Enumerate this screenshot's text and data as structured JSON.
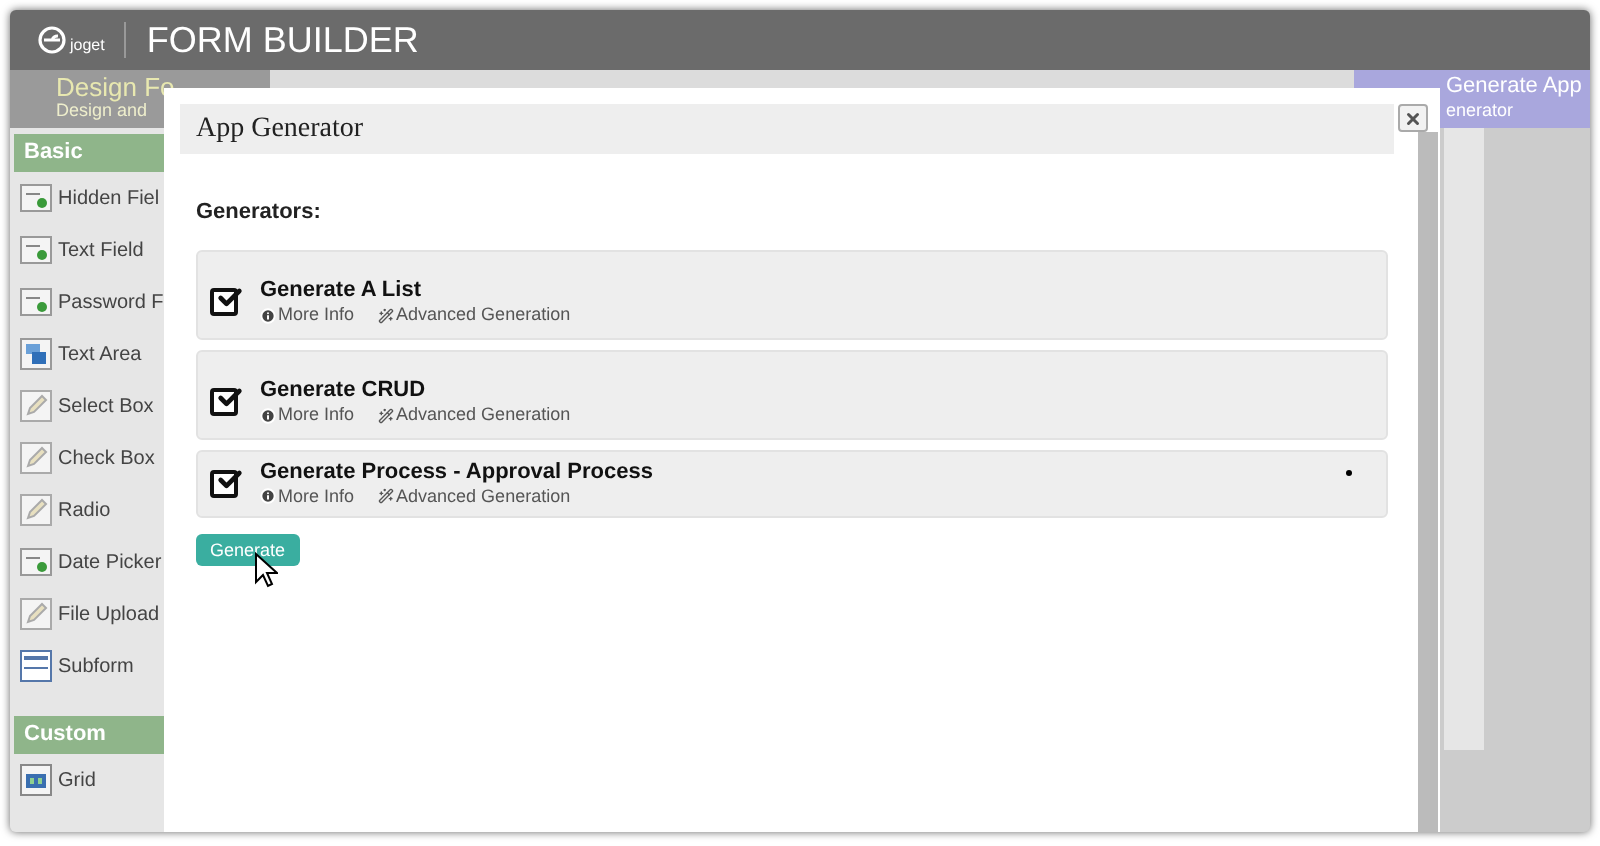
{
  "header": {
    "logo_text": "joget",
    "title": "FORM BUILDER"
  },
  "tabs": [
    {
      "title": "Design Fo",
      "subtitle": "Design and",
      "selected": true
    },
    {
      "title": "Generate App",
      "subtitle": "enerator",
      "selected": false
    }
  ],
  "palette": [
    {
      "heading": "Basic",
      "items": [
        {
          "label": "Hidden Fiel",
          "kind": "field"
        },
        {
          "label": "Text Field",
          "kind": "field"
        },
        {
          "label": "Password F",
          "kind": "field"
        },
        {
          "label": "Text Area",
          "kind": "textarea"
        },
        {
          "label": "Select Box",
          "kind": "edit"
        },
        {
          "label": "Check Box",
          "kind": "edit"
        },
        {
          "label": "Radio",
          "kind": "edit"
        },
        {
          "label": "Date Picker",
          "kind": "field"
        },
        {
          "label": "File Upload",
          "kind": "edit"
        },
        {
          "label": "Subform",
          "kind": "subform"
        }
      ]
    },
    {
      "heading": "Custom",
      "items": [
        {
          "label": "Grid",
          "kind": "grid"
        }
      ]
    }
  ],
  "dialog": {
    "title": "App Generator",
    "section_label": "Generators:",
    "generators": [
      {
        "label": "Generate A List",
        "checked": true,
        "more_info": "More Info",
        "advanced": "Advanced Generation",
        "marker": false
      },
      {
        "label": "Generate CRUD",
        "checked": true,
        "more_info": "More Info",
        "advanced": "Advanced Generation",
        "marker": false
      },
      {
        "label": "Generate Process - Approval Process",
        "checked": true,
        "more_info": "More Info",
        "advanced": "Advanced Generation",
        "marker": true
      }
    ],
    "button": "Generate"
  }
}
